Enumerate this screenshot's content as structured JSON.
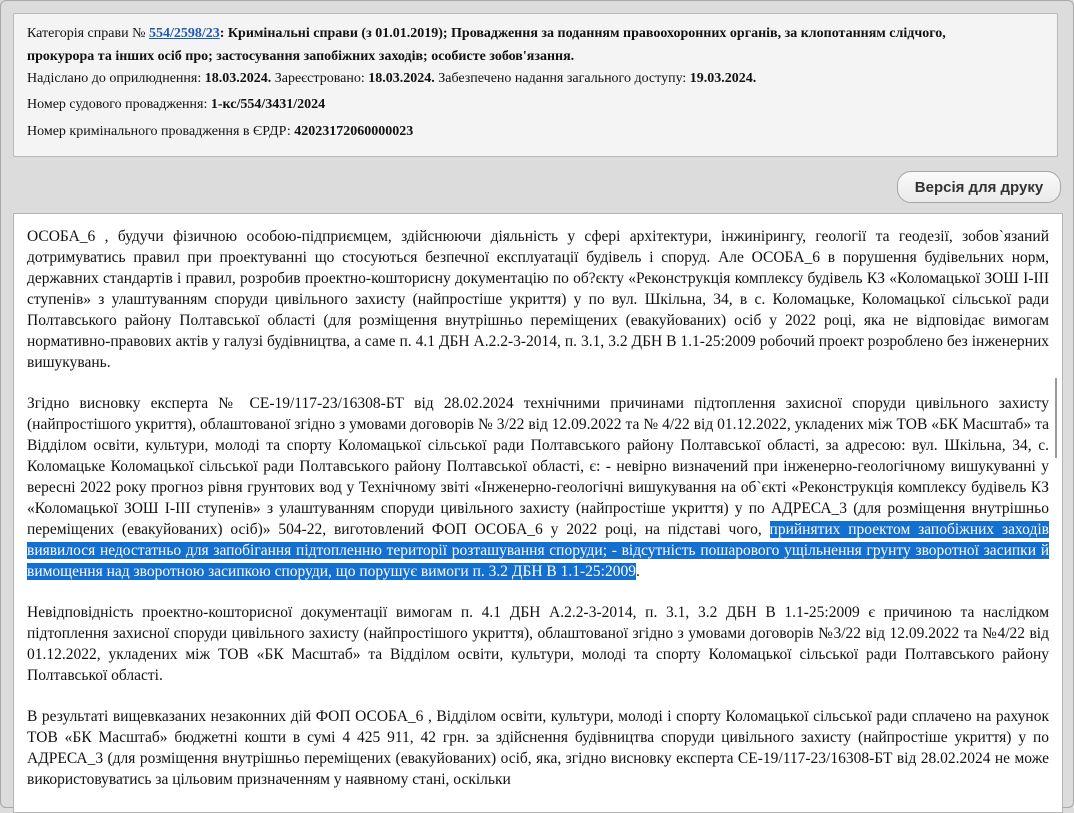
{
  "meta": {
    "category_prefix": "Категорія справи № ",
    "case_number": "554/2598/23",
    "category_text": ": Кримінальні справи (з 01.01.2019); Провадження за поданням правоохоронних органів, за клопотанням слідчого,",
    "category_text_2": "прокурора та інших осіб про; застосування запобіжних заходів; особисте зобов'язання.",
    "sent_label": "Надіслано до оприлюднення: ",
    "sent_date": "18.03.2024.",
    "registered_label": " Зареєстровано: ",
    "registered_date": "18.03.2024.",
    "access_label": " Забезпечено надання загального доступу: ",
    "access_date": "19.03.2024.",
    "court_proc_label": "Номер судового провадження: ",
    "court_proc_value": "1-кс/554/3431/2024",
    "erdr_label": "Номер кримінального провадження в ЄРДР: ",
    "erdr_value": "42023172060000023"
  },
  "print_button": "Версія для друку",
  "document": {
    "p1": "ОСОБА_6 , будучи фізичною особою-підприємцем, здійснюючи діяльність у сфері архітектури, інжинірингу, геології та геодезії, зобов`язаний дотримуватись правил при проектуванні що стосуються безпечної експлуатації будівель і споруд. Але ОСОБА_6 в порушення будівельних норм, державних стандартів і правил, розробив проектно-кошторисну документацію по об?єкту «Реконструкція комплексу будівель КЗ «Коломацької ЗОШ І-ІІІ ступенів» з улаштуванням споруди цивільного захисту (найпростіше укриття) у по вул. Шкільна, 34, в с. Коломацьке, Коломацької сільської ради Полтавського району Полтавської області (для розміщення внутрішньо переміщених (евакуйованих) осіб у 2022 році, яка не відповідає вимогам нормативно-правових актів у галузі будівництва, а саме п. 4.1 ДБН А.2.2-3-2014, п. 3.1, 3.2 ДБН В 1.1-25:2009 робочий проект розроблено без інженерних вишукувань.",
    "p2_before": "Згідно висновку експерта № СЕ-19/117-23/16308-БТ від 28.02.2024 технічними причинами підтоплення захисної споруди цивільного захисту (найпростішого укриття), облаштованої згідно з умовами договорів № 3/22 від 12.09.2022 та № 4/22 від 01.12.2022, укладених між ТОВ «БК Масштаб» та Відділом освіти, культури, молоді та спорту Коломацької сільської ради Полтавського району Полтавської області, за адресою: вул. Шкільна, 34, с. Коломацьке Коломацької сільської ради Полтавського району Полтавської області, є: - невірно визначений при інженерно-геологічному вишукуванні у вересні 2022 року прогноз рівня грунтових вод у Технічному звіті «Інженерно-геологічні вишукування на об`єкті «Реконструкція комплексу будівель КЗ «Коломацької ЗОШ І-ІІІ ступенів» з улаштуванням споруди цивільного захисту (найпростіше укриття) у по АДРЕСА_3 (для розміщення внутрішньо переміщених (евакуйованих) осіб)» 504-22, виготовлений ФОП ОСОБА_6 у 2022 році, на підставі чого, ",
    "p2_highlight": "прийнятих проектом запобіжних заходів виявилося недостатньо для запобігання підтопленню території розташування споруди; - відсутність пошарового ущільнення грунту зворотної засипки й вимощення над зворотною засипкою споруди, що порушує вимоги п. 3.2 ДБН В 1.1-25:2009",
    "p2_after": ".",
    "p3": "Невідповідність проектно-кошторисної документації вимогам п. 4.1 ДБН А.2.2-3-2014, п. 3.1, 3.2 ДБН В 1.1-25:2009 є причиною та наслідком підтоплення захисної споруди цивільного захисту (найпростішого укриття), облаштованої згідно з умовами договорів №3/22 від 12.09.2022 та №4/22 від 01.12.2022, укладених між ТОВ «БК Масштаб» та Відділом освіти, культури, молоді та спорту Коломацької сільської ради Полтавського району Полтавської області.",
    "p4": "В результаті вищевказаних незаконних дій ФОП ОСОБА_6 , Відділом освіти, культури, молоді і спорту Коломацької сільської ради сплачено на рахунок ТОВ «БК Масштаб» бюджетні кошти в сумі 4 425 911, 42 грн. за здійснення будівництва споруди цивільного захисту (найпростіше укриття) у по АДРЕСА_3 (для розміщення внутрішньо переміщених (евакуйованих) осіб, яка, згідно висновку експерта СЕ-19/117-23/16308-БТ від 28.02.2024 не може використовуватись за цільовим призначенням у наявному стані, оскільки"
  }
}
